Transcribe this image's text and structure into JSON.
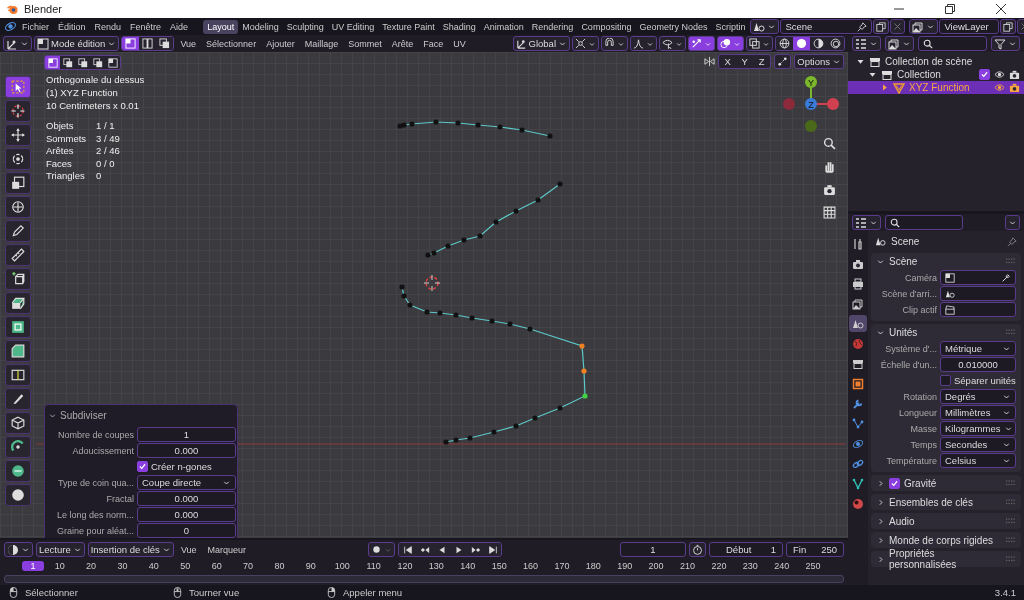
{
  "window": {
    "title": "Blender"
  },
  "menus": [
    "Fichier",
    "Édition",
    "Rendu",
    "Fenêtre",
    "Aide"
  ],
  "workspaces": [
    {
      "label": "Layout",
      "selected": true
    },
    {
      "label": "Modeling",
      "selected": false
    },
    {
      "label": "Sculpting",
      "selected": false
    },
    {
      "label": "UV Editing",
      "selected": false
    },
    {
      "label": "Texture Paint",
      "selected": false
    },
    {
      "label": "Shading",
      "selected": false
    },
    {
      "label": "Animation",
      "selected": false
    },
    {
      "label": "Rendering",
      "selected": false
    },
    {
      "label": "Compositing",
      "selected": false
    },
    {
      "label": "Geometry Nodes",
      "selected": false
    },
    {
      "label": "Scriptin",
      "selected": false
    }
  ],
  "scene_field": "Scene",
  "view_layer_field": "ViewLayer",
  "viewport_header": {
    "mode": "Mode édition",
    "select_modes": [
      {
        "kind": "vertex",
        "selected": true
      },
      {
        "kind": "edge",
        "selected": false
      },
      {
        "kind": "face",
        "selected": false
      }
    ],
    "menus": [
      "Vue",
      "Sélectionner",
      "Ajouter",
      "Maillage",
      "Sommet",
      "Arête",
      "Face",
      "UV"
    ],
    "orientation": "Global",
    "toggles": [
      {
        "kind": "pivot",
        "on": false
      },
      {
        "kind": "snap",
        "on": false
      },
      {
        "kind": "proportional",
        "on": false
      },
      {
        "kind": "visibility",
        "on": false
      },
      {
        "kind": "gizmos",
        "on": true
      },
      {
        "kind": "overlays",
        "on": true
      },
      {
        "kind": "xray",
        "on": false
      }
    ],
    "shading": [
      {
        "kind": "wireframe",
        "selected": false
      },
      {
        "kind": "solid",
        "selected": true
      },
      {
        "kind": "material",
        "selected": false
      },
      {
        "kind": "rendered",
        "selected": false
      }
    ]
  },
  "viewport": {
    "overlay_text": [
      "Orthogonale du dessus",
      "(1) XYZ Function",
      "10 Centimeters x 0.01"
    ],
    "stats": [
      {
        "label": "Objets",
        "value": "1 / 1"
      },
      {
        "label": "Sommets",
        "value": "3 / 49"
      },
      {
        "label": "Arêtes",
        "value": "2 / 46"
      },
      {
        "label": "Faces",
        "value": "0 / 0"
      },
      {
        "label": "Triangles",
        "value": "0"
      }
    ],
    "mirror_axes": [
      "X",
      "Y",
      "Z"
    ],
    "options": "Options",
    "gizmo_axes": [
      "Y",
      "Z"
    ],
    "tools": [
      {
        "kind": "select",
        "selected": true
      },
      {
        "kind": "cursor",
        "selected": false
      },
      {
        "kind": "move",
        "selected": false
      },
      {
        "kind": "rotate",
        "selected": false
      },
      {
        "kind": "scale",
        "selected": false
      },
      {
        "kind": "transform",
        "selected": false
      },
      {
        "kind": "annotate",
        "selected": false
      },
      {
        "kind": "measure",
        "selected": false
      },
      {
        "kind": "add",
        "selected": false
      },
      {
        "kind": "extrude",
        "selected": false
      },
      {
        "kind": "inset",
        "selected": false
      },
      {
        "kind": "bevel",
        "selected": false
      },
      {
        "kind": "loopcut",
        "selected": false
      },
      {
        "kind": "knife",
        "selected": false
      },
      {
        "kind": "polybuild",
        "selected": false
      },
      {
        "kind": "spin",
        "selected": false
      },
      {
        "kind": "smooth",
        "selected": false
      },
      {
        "kind": "shrink",
        "selected": false
      }
    ]
  },
  "operator_panel": {
    "title": "Subdiviser",
    "expanded": true,
    "fields": [
      {
        "kind": "number",
        "label": "Nombre de coupes",
        "value": "1"
      },
      {
        "kind": "number",
        "label": "Adoucissement",
        "value": "0.000"
      },
      {
        "kind": "checkbox",
        "label": "Créer n-gones",
        "checked": true
      },
      {
        "kind": "dropdown",
        "label": "Type de coin qua...",
        "value": "Coupe directe"
      },
      {
        "kind": "number",
        "label": "Fractal",
        "value": "0.000"
      },
      {
        "kind": "number",
        "label": "Le long des norm...",
        "value": "0.000"
      },
      {
        "kind": "number",
        "label": "Graine pour aléat...",
        "value": "0"
      }
    ]
  },
  "outliner": {
    "items": [
      {
        "label": "Collection de scène",
        "kind": "scene_collection",
        "selected": false,
        "children": [
          {
            "label": "Collection",
            "kind": "collection",
            "selected": false,
            "expanded": true,
            "checked": true,
            "children": [
              {
                "label": "XYZ Function",
                "kind": "mesh_object",
                "selected": true,
                "expanded": false
              }
            ]
          }
        ]
      }
    ]
  },
  "properties": {
    "context": "Scene",
    "tabs": [
      {
        "kind": "tool",
        "selected": false
      },
      {
        "kind": "render",
        "selected": false
      },
      {
        "kind": "output",
        "selected": false
      },
      {
        "kind": "view_layer",
        "selected": false
      },
      {
        "kind": "scene",
        "selected": true
      },
      {
        "kind": "world",
        "selected": false
      },
      {
        "kind": "collection",
        "selected": false
      },
      {
        "kind": "object",
        "selected": false
      },
      {
        "kind": "modifiers",
        "selected": false
      },
      {
        "kind": "particles",
        "selected": false
      },
      {
        "kind": "physics",
        "selected": false
      },
      {
        "kind": "constraints",
        "selected": false
      },
      {
        "kind": "data",
        "selected": false
      },
      {
        "kind": "material",
        "selected": false
      }
    ],
    "panels": [
      {
        "title": "Scène",
        "expanded": true,
        "rows": [
          {
            "kind": "picker",
            "label": "Caméra"
          },
          {
            "kind": "picker",
            "label": "Scène d'arri..."
          },
          {
            "kind": "picker",
            "label": "Clip actif"
          }
        ]
      },
      {
        "title": "Unités",
        "expanded": true,
        "rows": [
          {
            "kind": "dropdown",
            "label": "Système d'...",
            "value": "Métrique"
          },
          {
            "kind": "number",
            "label": "Échelle d'un...",
            "value": "0.010000"
          },
          {
            "kind": "checkbox",
            "label": "Séparer unités",
            "checked": false
          },
          {
            "kind": "dropdown",
            "label": "Rotation",
            "value": "Degrés"
          },
          {
            "kind": "dropdown",
            "label": "Longueur",
            "value": "Millimètres"
          },
          {
            "kind": "dropdown",
            "label": "Masse",
            "value": "Kilogrammes"
          },
          {
            "kind": "dropdown",
            "label": "Temps",
            "value": "Secondes"
          },
          {
            "kind": "dropdown",
            "label": "Température",
            "value": "Celsius"
          }
        ]
      },
      {
        "title": "Gravité",
        "expanded": false,
        "checked": true
      },
      {
        "title": "Ensembles de clés",
        "expanded": false
      },
      {
        "title": "Audio",
        "expanded": false
      },
      {
        "title": "Monde de corps rigides",
        "expanded": false
      },
      {
        "title": "Propriétés personnalisées",
        "expanded": false
      }
    ]
  },
  "timeline": {
    "menus": [
      {
        "label": "Lecture",
        "kind": "dropdown"
      },
      {
        "label": "Insertion de clés",
        "kind": "dropdown"
      },
      {
        "label": "Vue",
        "kind": "menu"
      },
      {
        "label": "Marqueur",
        "kind": "menu"
      }
    ],
    "current_frame": "1",
    "start_label": "Début",
    "start": "1",
    "end_label": "Fin",
    "end": "250",
    "ruler": [
      {
        "label": "1",
        "selected": true
      },
      {
        "label": "10",
        "selected": false
      },
      {
        "label": "20",
        "selected": false
      },
      {
        "label": "30",
        "selected": false
      },
      {
        "label": "40",
        "selected": false
      },
      {
        "label": "50",
        "selected": false
      },
      {
        "label": "60",
        "selected": false
      },
      {
        "label": "70",
        "selected": false
      },
      {
        "label": "80",
        "selected": false
      },
      {
        "label": "90",
        "selected": false
      },
      {
        "label": "100",
        "selected": false
      },
      {
        "label": "110",
        "selected": false
      },
      {
        "label": "120",
        "selected": false
      },
      {
        "label": "130",
        "selected": false
      },
      {
        "label": "140",
        "selected": false
      },
      {
        "label": "150",
        "selected": false
      },
      {
        "label": "160",
        "selected": false
      },
      {
        "label": "170",
        "selected": false
      },
      {
        "label": "180",
        "selected": false
      },
      {
        "label": "190",
        "selected": false
      },
      {
        "label": "200",
        "selected": false
      },
      {
        "label": "210",
        "selected": false
      },
      {
        "label": "220",
        "selected": false
      },
      {
        "label": "230",
        "selected": false
      },
      {
        "label": "240",
        "selected": false
      },
      {
        "label": "250",
        "selected": false
      }
    ]
  },
  "status_bar": {
    "items": [
      {
        "label": "Sélectionner",
        "kind": "left_click"
      },
      {
        "label": "Tourner vue",
        "kind": "middle_click"
      },
      {
        "label": "Appeler menu",
        "kind": "right_click"
      }
    ],
    "version": "3.4.1"
  }
}
